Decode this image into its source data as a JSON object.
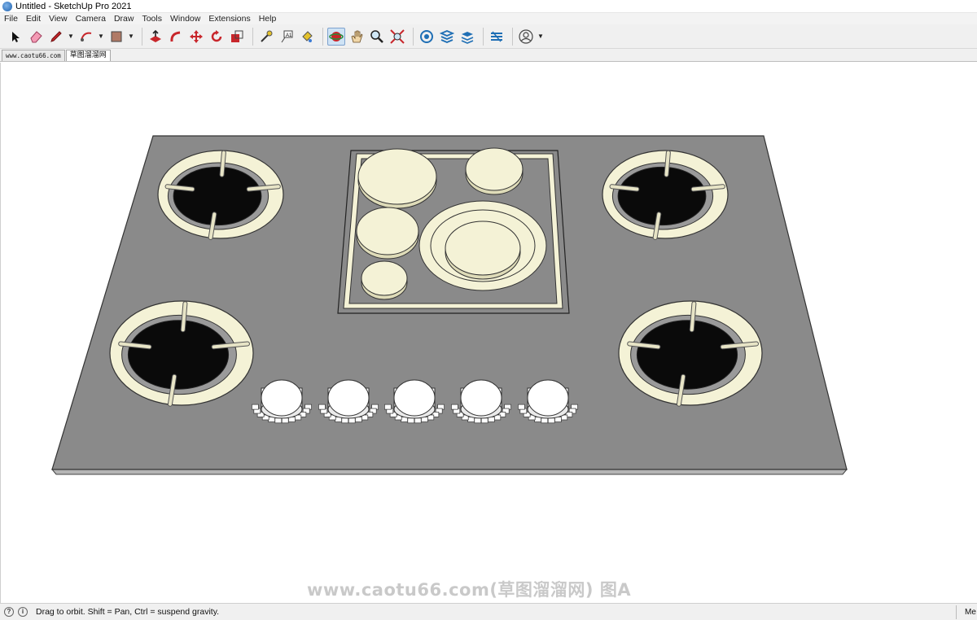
{
  "window": {
    "title": "Untitled - SketchUp Pro 2021"
  },
  "menu": [
    "File",
    "Edit",
    "View",
    "Camera",
    "Draw",
    "Tools",
    "Window",
    "Extensions",
    "Help"
  ],
  "toolbar": {
    "tools": [
      {
        "name": "select-tool",
        "icon": "arrow-cursor-icon"
      },
      {
        "name": "eraser-tool",
        "icon": "eraser-icon"
      },
      {
        "name": "line-tool",
        "icon": "pencil-icon"
      },
      {
        "name": "arc-tool",
        "icon": "arc-icon"
      },
      {
        "name": "shape-tool",
        "icon": "rectangle-icon"
      },
      {
        "name": "push-pull-tool",
        "icon": "push-pull-icon"
      },
      {
        "name": "follow-me-tool",
        "icon": "follow-me-icon"
      },
      {
        "name": "move-tool",
        "icon": "move-icon"
      },
      {
        "name": "rotate-tool",
        "icon": "rotate-icon"
      },
      {
        "name": "scale-tool",
        "icon": "scale-icon"
      },
      {
        "name": "tape-measure-tool",
        "icon": "tape-measure-icon"
      },
      {
        "name": "text-tool",
        "icon": "text-icon"
      },
      {
        "name": "paint-bucket-tool",
        "icon": "paint-bucket-icon"
      },
      {
        "name": "orbit-tool",
        "icon": "orbit-icon"
      },
      {
        "name": "pan-tool",
        "icon": "hand-icon"
      },
      {
        "name": "zoom-tool",
        "icon": "magnifier-icon"
      },
      {
        "name": "zoom-extents-tool",
        "icon": "zoom-extents-icon"
      },
      {
        "name": "3d-warehouse",
        "icon": "warehouse-icon"
      },
      {
        "name": "extension-warehouse",
        "icon": "extension-icon"
      },
      {
        "name": "layout",
        "icon": "layout-icon"
      },
      {
        "name": "send-to-layout",
        "icon": "send-layout-icon"
      },
      {
        "name": "account",
        "icon": "user-icon"
      }
    ],
    "active_tool": "orbit-tool"
  },
  "tabs": [
    {
      "label": "www.caotu66.com",
      "selected": false
    },
    {
      "label": "草图溜溜网",
      "selected": true
    }
  ],
  "watermark": "www.caotu66.com(草图溜溜网) 图A",
  "status": {
    "hint": "Drag to orbit. Shift = Pan, Ctrl = suspend gravity.",
    "measurements_label": "Me"
  },
  "colors": {
    "cooktop": "#8a8a8a",
    "trim": "#f4f2d6",
    "burner": "#0a0a0a",
    "knob": "#ffffff",
    "selection": "#cfe3f5"
  }
}
